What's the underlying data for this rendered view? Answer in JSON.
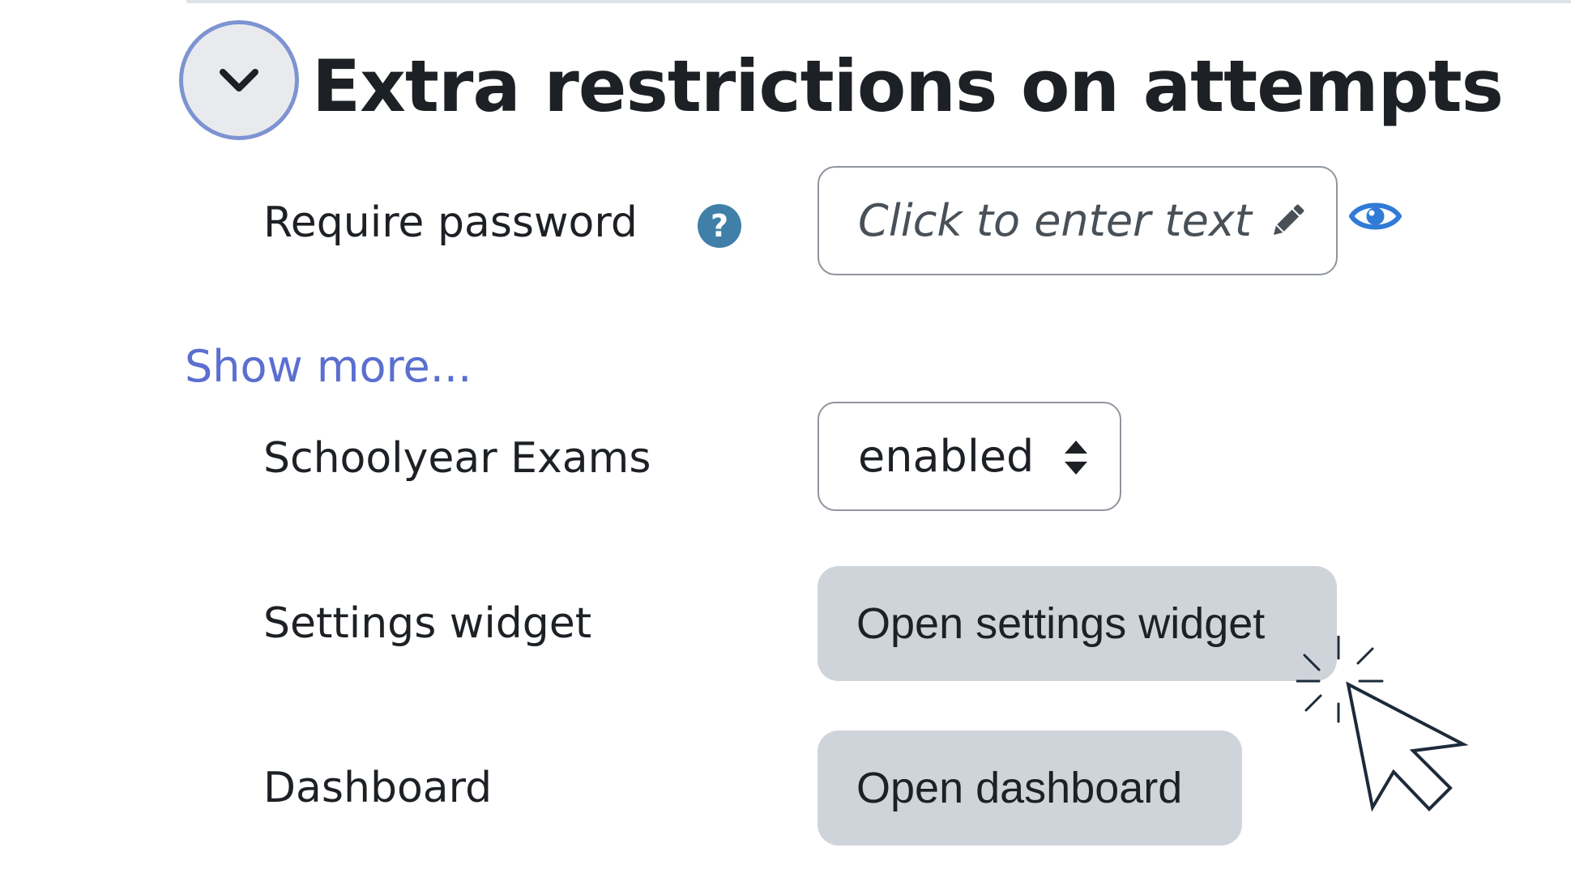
{
  "section": {
    "title": "Extra restrictions on attempts",
    "toggle_icon": "chevron-down-icon"
  },
  "password": {
    "label": "Require password",
    "help_icon": "question-circle-icon",
    "help_glyph": "?",
    "placeholder": "Click to enter text",
    "edit_icon": "pencil-icon",
    "reveal_icon": "eye-icon"
  },
  "show_more": {
    "label": "Show more..."
  },
  "exams": {
    "label": "Schoolyear Exams",
    "selected": "enabled",
    "arrows_icon": "sort-arrows-icon"
  },
  "settings_widget": {
    "label": "Settings widget",
    "button_label": "Open settings widget"
  },
  "dashboard": {
    "label": "Dashboard",
    "button_label": "Open dashboard"
  },
  "colors": {
    "accent_ring": "#7e93d2",
    "link": "#5b6fd0",
    "help_icon": "#3f7fa8",
    "button_bg": "#ced4da"
  }
}
